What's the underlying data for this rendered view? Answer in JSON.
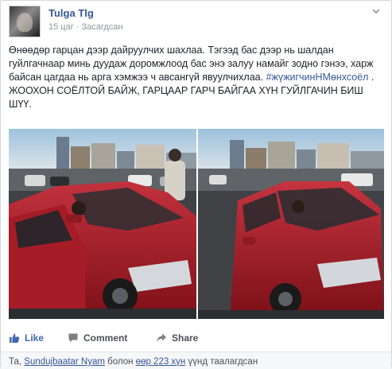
{
  "post": {
    "author": "Tulga Tlg",
    "time": "15 цаг",
    "separator": " · ",
    "privacy": "Засагдсан",
    "text_main": "Өнөөдөр гарцан дээр дайруулчих шахлаа. Тэгээд бас дээр нь шалдан гуйлгачнаар минь дуудаж доромжлоод бас энэ залуу намайг зодно гэнээ, харж байсан цагдаа нь арга хэмжээ ч авсангүй явуулчихлаа.",
    "hashtag": "#жүжигчинНМөнхсоёл",
    "text_tail": " . ЖООХОН СОЁЛТОЙ БАЙЖ, ГАРЦААР ГАРЧ БАЙГАА ХҮН ГУЙЛГАЧИН БИШ ШҮҮ."
  },
  "actions": {
    "like": "Like",
    "comment": "Comment",
    "share": "Share"
  },
  "likes": {
    "prefix": "Та, ",
    "person": "Sundujbaatar Nyam",
    "middle": " болон ",
    "others": "өөр 223 хүн",
    "suffix": " үүнд таалагдсан"
  },
  "icons": {
    "header_menu": "chevron-down-icon",
    "privacy": "globe-icon",
    "like": "thumbs-up-icon",
    "comment": "comment-icon",
    "share": "share-arrow-icon"
  },
  "colors": {
    "link": "#365899",
    "like_active": "#4267b2",
    "meta": "#90949c",
    "car_red": "#b3202c"
  }
}
